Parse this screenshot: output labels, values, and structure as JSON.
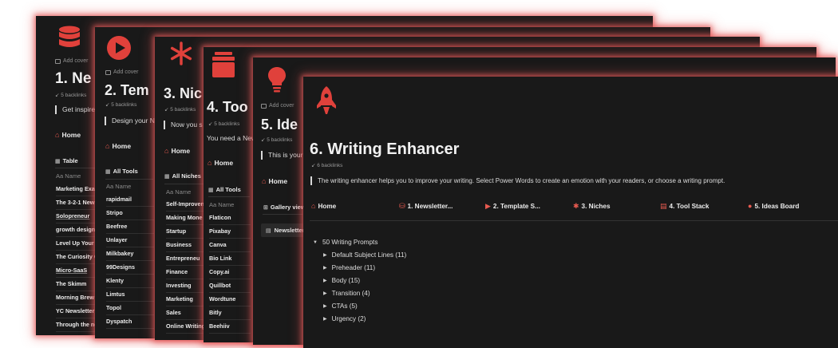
{
  "colors": {
    "accent": "#e0413b",
    "glow": "#e65a5a",
    "background": "#191919"
  },
  "common": {
    "add_cover": "Add cover",
    "backlinks": "5 backlinks",
    "home": "Home",
    "column_name": "Aa Name"
  },
  "win1": {
    "icon": "database-icon",
    "title": "1. Ne",
    "quote": "Get inspired",
    "view_tab": "Table",
    "rows": [
      "Marketing Exar",
      "The 3-2-1 News",
      "Solopreneur",
      "growth design",
      "Level Up Your I",
      "The Curiosity C",
      "Micro-SaaS",
      "The Skimm",
      "Morning Brew",
      "YC Newsletter",
      "Through the ne"
    ]
  },
  "win2": {
    "icon": "play-circle-icon",
    "title": "2. Tem",
    "quote": "Design your N",
    "view_tab": "All Tools",
    "rows": [
      "rapidmail",
      "Stripo",
      "Beefree",
      "Unlayer",
      "Milkbakey",
      "99Designs",
      "Klenty",
      "Limtus",
      "Topol",
      "Dyspatch"
    ]
  },
  "win3": {
    "icon": "asterisk-icon",
    "title": "3. Nic",
    "quote": "Now you s",
    "view_tab": "All Niches",
    "rows": [
      "Self-Improven",
      "Making Mone",
      "Startup",
      "Business",
      "Entrepreneu",
      "Finance",
      "Investing",
      "Marketing",
      "Sales",
      "Online Writing"
    ]
  },
  "win4": {
    "icon": "archive-icon",
    "title": "4. Too",
    "quote": "You need a New",
    "view_tab": "All Tools",
    "rows": [
      "Flaticon",
      "Pixabay",
      "Canva",
      "Bio Link",
      "Copy.ai",
      "Quillbot",
      "Wordtune",
      "Bitly",
      "Beehiiv"
    ]
  },
  "win5": {
    "icon": "lightbulb-icon",
    "title": "5. Ide",
    "quote": "This is your",
    "view_tab": "Gallery view",
    "card": "Newsletter"
  },
  "win6": {
    "icon": "rocket-icon",
    "title": "6. Writing Enhancer",
    "backlinks": "6 backlinks",
    "quote": "The writing enhancer helps you to improve your writing. Select Power Words to create an emotion with your readers, or choose a writing prompt.",
    "nav": [
      "Home",
      "1. Newsletter...",
      "2. Template S...",
      "3. Niches",
      "4. Tool Stack",
      "5. Ideas Board"
    ],
    "prompts_header": "50 Writing Prompts",
    "prompts": [
      "Default Subject Lines (11)",
      "Preheader (11)",
      "Body (15)",
      "Transition (4)",
      "CTAs (5)",
      "Urgency (2)"
    ]
  }
}
